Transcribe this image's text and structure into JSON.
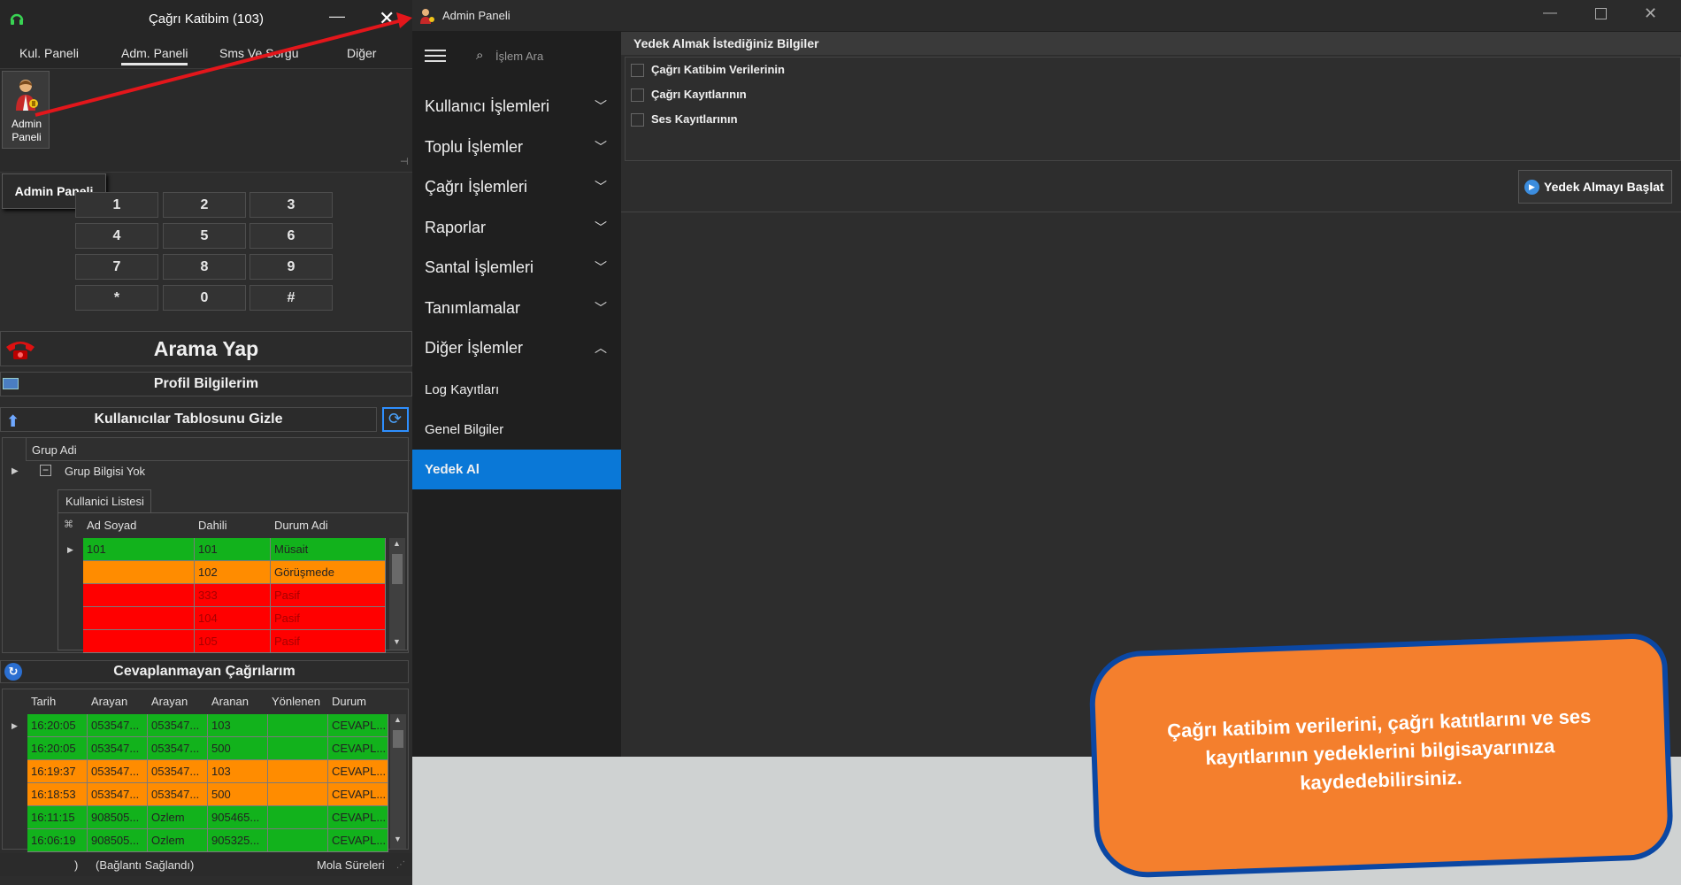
{
  "left_app": {
    "title": "Çağrı Katibim (103)",
    "tabs": [
      {
        "label": "Kul. Paneli"
      },
      {
        "label": "Adm. Paneli"
      },
      {
        "label": "Sms Ve Sorgu"
      },
      {
        "label": "Diğer"
      }
    ],
    "admin_button_label": "Admin\nPaneli",
    "admin_button_line1": "Admin",
    "admin_button_line2": "Paneli",
    "tooltip": "Admin Paneli",
    "keypad": [
      "1",
      "2",
      "3",
      "4",
      "5",
      "6",
      "7",
      "8",
      "9",
      "*",
      "0",
      "#"
    ],
    "call_button": "Arama Yap",
    "profile_bar": "Profil Bilgilerim",
    "users_toggle": "Kullanıcılar Tablosunu Gizle",
    "group_header": "Grup Adi",
    "group_row": "Grup Bilgisi Yok",
    "user_list_tab": "Kullanici Listesi",
    "user_columns": [
      "Ad Soyad",
      "Dahili",
      "Durum Adi"
    ],
    "users": [
      {
        "name": "101",
        "ext": "101",
        "status": "Müsait",
        "color": "green"
      },
      {
        "name": "",
        "ext": "102",
        "status": "Görüşmede",
        "color": "orange"
      },
      {
        "name": "",
        "ext": "333",
        "status": "Pasif",
        "color": "red"
      },
      {
        "name": "",
        "ext": "104",
        "status": "Pasif",
        "color": "red"
      },
      {
        "name": "",
        "ext": "105",
        "status": "Pasif",
        "color": "red"
      }
    ],
    "missed_calls_bar": "Cevaplanmayan Çağrılarım",
    "call_columns": [
      "Tarih",
      "Arayan",
      "Arayan",
      "Aranan",
      "Yönlenen",
      "Durum"
    ],
    "calls": [
      {
        "time": "16:20:05",
        "caller1": "053547...",
        "caller2": "053547...",
        "called": "103",
        "routed": "",
        "status": "CEVAPL...",
        "color": "green"
      },
      {
        "time": "16:20:05",
        "caller1": "053547...",
        "caller2": "053547...",
        "called": "500",
        "routed": "",
        "status": "CEVAPL...",
        "color": "green"
      },
      {
        "time": "16:19:37",
        "caller1": "053547...",
        "caller2": "053547...",
        "called": "103",
        "routed": "",
        "status": "CEVAPL...",
        "color": "orange"
      },
      {
        "time": "16:18:53",
        "caller1": "053547...",
        "caller2": "053547...",
        "called": "500",
        "routed": "",
        "status": "CEVAPL...",
        "color": "orange"
      },
      {
        "time": "16:11:15",
        "caller1": "908505...",
        "caller2": "Ozlem",
        "called": "905465...",
        "routed": "",
        "status": "CEVAPL...",
        "color": "green"
      },
      {
        "time": "16:06:19",
        "caller1": "908505...",
        "caller2": "Ozlem",
        "called": "905325...",
        "routed": "",
        "status": "CEVAPL...",
        "color": "green"
      }
    ],
    "status_left": ")",
    "status_conn": "(Bağlantı Sağlandı)",
    "status_right": "Mola Süreleri"
  },
  "right_app": {
    "title": "Admin Paneli",
    "search_placeholder": "İşlem Ara",
    "nav": [
      {
        "label": "Kullanıcı İşlemleri",
        "chevron": "down"
      },
      {
        "label": "Toplu İşlemler",
        "chevron": "down"
      },
      {
        "label": "Çağrı İşlemleri",
        "chevron": "down"
      },
      {
        "label": "Raporlar",
        "chevron": "down"
      },
      {
        "label": "Santal İşlemleri",
        "chevron": "down"
      },
      {
        "label": "Tanımlamalar",
        "chevron": "down"
      },
      {
        "label": "Diğer İşlemler",
        "chevron": "up"
      }
    ],
    "subnav": [
      {
        "label": "Log Kayıtları",
        "selected": false
      },
      {
        "label": "Genel Bilgiler",
        "selected": false
      },
      {
        "label": "Yedek Al",
        "selected": true
      }
    ],
    "panel_header": "Yedek Almak İstediğiniz Bilgiler",
    "options": [
      {
        "label": "Çağrı Katibim Verilerinin",
        "checked": false
      },
      {
        "label": "Çağrı Kayıtlarının",
        "checked": false
      },
      {
        "label": "Ses Kayıtlarının",
        "checked": false
      }
    ],
    "start_button": "Yedek Almayı Başlat"
  },
  "callout": "Çağrı katibim verilerini, çağrı katıtlarını ve ses kayıtlarının yedeklerini bilgisayarınıza kaydedebilirsiniz.",
  "colors": {
    "accent": "#0a78d7",
    "green": "#12b21c",
    "orange": "#ff8c00",
    "red": "#ff0000",
    "callout": "#f47f2d",
    "callout_border": "#0b47a3",
    "arrow": "#e3161b"
  }
}
